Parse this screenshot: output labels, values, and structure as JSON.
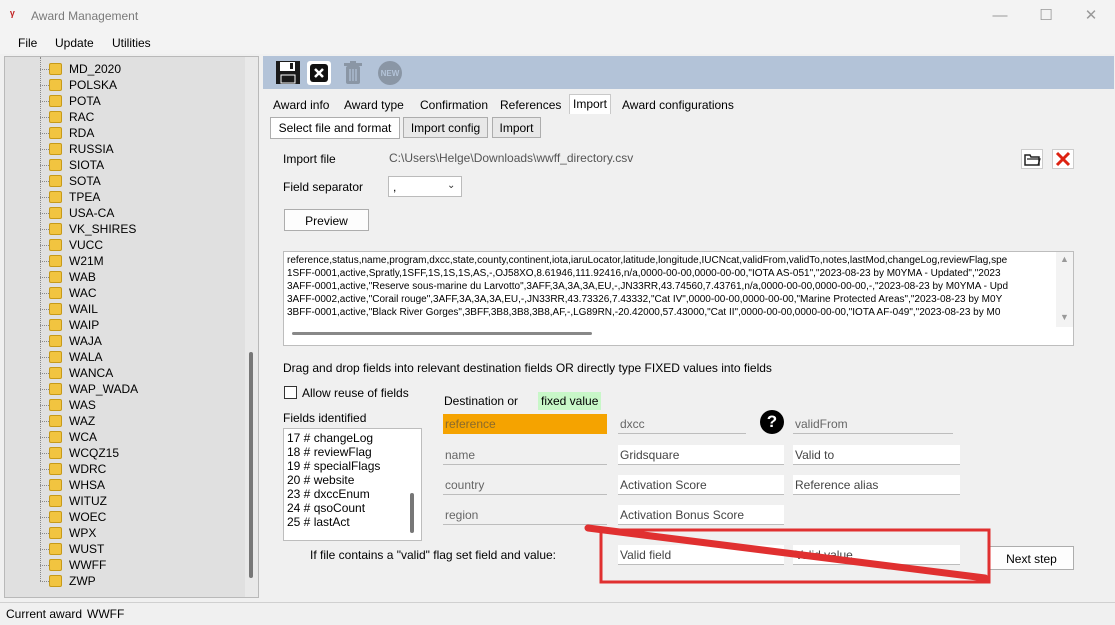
{
  "window": {
    "title": "Award Management",
    "minimize": "—",
    "maximize": "☐",
    "close": "✕",
    "app_icon": "ᵞ"
  },
  "menu": [
    "File",
    "Update",
    "Utilities"
  ],
  "tree": {
    "items": [
      "MD_2020",
      "POLSKA",
      "POTA",
      "RAC",
      "RDA",
      "RUSSIA",
      "SIOTA",
      "SOTA",
      "TPEA",
      "USA-CA",
      "VK_SHIRES",
      "VUCC",
      "W21M",
      "WAB",
      "WAC",
      "WAIL",
      "WAIP",
      "WAJA",
      "WALA",
      "WANCA",
      "WAP_WADA",
      "WAS",
      "WAZ",
      "WCA",
      "WCQZ15",
      "WDRC",
      "WHSA",
      "WITUZ",
      "WOEC",
      "WPX",
      "WUST",
      "WWFF",
      "ZWP"
    ]
  },
  "toolbar": {
    "icons": [
      "save-icon",
      "close-icon",
      "trash-icon",
      "new-icon"
    ],
    "new_label": "NEW"
  },
  "tabs": [
    "Award info",
    "Award type",
    "Confirmation",
    "References",
    "Import",
    "Award configurations"
  ],
  "subtabs": [
    "Select file and format",
    "Import config",
    "Import"
  ],
  "import": {
    "file_label": "Import file",
    "file_value": "C:\\Users\\Helge\\Downloads\\wwff_directory.csv",
    "separator_label": "Field separator",
    "separator_value": ",",
    "preview_button": "Preview",
    "csv_lines": [
      "reference,status,name,program,dxcc,state,county,continent,iota,iaruLocator,latitude,longitude,IUCNcat,validFrom,validTo,notes,lastMod,changeLog,reviewFlag,spe",
      "1SFF-0001,active,Spratly,1SFF,1S,1S,1S,AS,-,OJ58XO,8.61946,111.92416,n/a,0000-00-00,0000-00-00,\"IOTA AS-051\",\"2023-08-23 by M0YMA - Updated\",\"2023",
      "3AFF-0001,active,\"Reserve sous-marine du Larvotto\",3AFF,3A,3A,3A,EU,-,JN33RR,43.74560,7.43761,n/a,0000-00-00,0000-00-00,-,\"2023-08-23 by M0YMA - Upd",
      "3AFF-0002,active,\"Corail rouge\",3AFF,3A,3A,3A,EU,-,JN33RR,43.73326,7.43332,\"Cat IV\",0000-00-00,0000-00-00,\"Marine Protected Areas\",\"2023-08-23 by M0Y",
      "3BFF-0001,active,\"Black River Gorges\",3BFF,3B8,3B8,3B8,AF,-,LG89RN,-20.42000,57.43000,\"Cat II\",0000-00-00,0000-00-00,\"IOTA AF-049\",\"2023-08-23 by M0"
    ],
    "drag_hint": "Drag and drop fields into relevant destination fields OR directly type FIXED values into fields",
    "allow_reuse": "Allow reuse of fields",
    "fields_identified": "Fields identified",
    "field_list": [
      "17 # changeLog",
      "18 # reviewFlag",
      "19 # specialFlags",
      "20 # website",
      "23 # dxccEnum",
      "24 # qsoCount",
      "25 # lastAct"
    ],
    "dest_label": "Destination or",
    "fixed_label": "fixed value",
    "destinations": {
      "reference": "reference",
      "dxcc": "dxcc",
      "validFrom": "validFrom",
      "name": "name",
      "gridsquare": "Gridsquare",
      "valid_to": "Valid to",
      "country": "country",
      "activation_score": "Activation Score",
      "reference_alias": "Reference alias",
      "region": "region",
      "activation_bonus": "Activation Bonus Score"
    },
    "valid_flag_text": "If file contains a \"valid\" flag set field and value:",
    "valid_field": "Valid field",
    "valid_value": "Valid value",
    "next_step": "Next step"
  },
  "status": {
    "label": "Current award",
    "value": "WWFF"
  },
  "colors": {
    "highlight_orange": "#f5a300",
    "fixed_green": "#c8f7c8",
    "annotation_red": "#e03030",
    "toolbar_blue": "#b3c3d8"
  }
}
